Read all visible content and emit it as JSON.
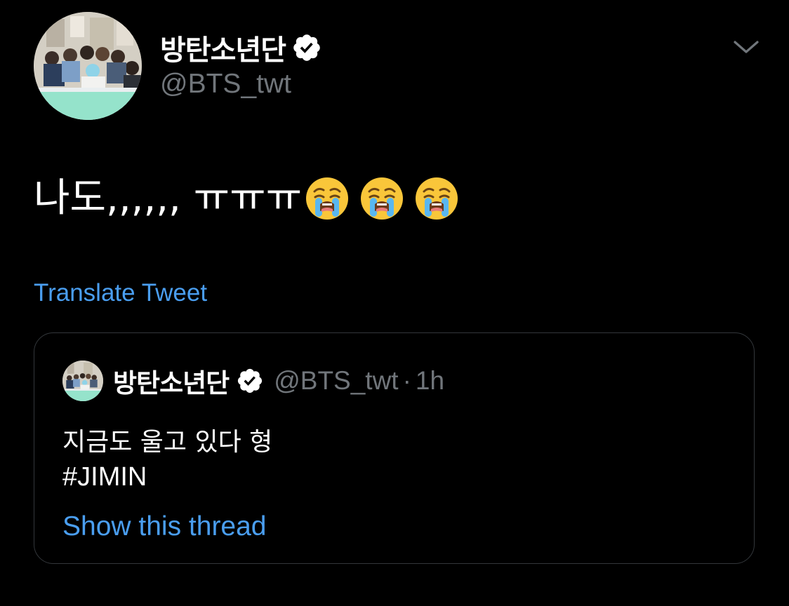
{
  "tweet": {
    "author": {
      "display_name": "방탄소년단",
      "handle": "@BTS_twt",
      "verified_icon": "verified-badge-icon"
    },
    "menu_icon": "chevron-down-icon",
    "text": "나도,,,,,, ㅠㅠㅠ",
    "emojis": [
      "loudly-crying-face-emoji",
      "loudly-crying-face-emoji",
      "loudly-crying-face-emoji"
    ],
    "translate_label": "Translate Tweet"
  },
  "quoted_tweet": {
    "display_name": "방탄소년단",
    "handle": "@BTS_twt",
    "separator": "·",
    "time": "1h",
    "line1": "지금도 울고 있다 형",
    "line2": "#JIMIN",
    "show_thread_label": "Show this thread"
  },
  "colors": {
    "background": "#000000",
    "text": "#ffffff",
    "secondary_text": "#71767b",
    "link": "#4a9ef0",
    "card_border": "#33373b"
  }
}
